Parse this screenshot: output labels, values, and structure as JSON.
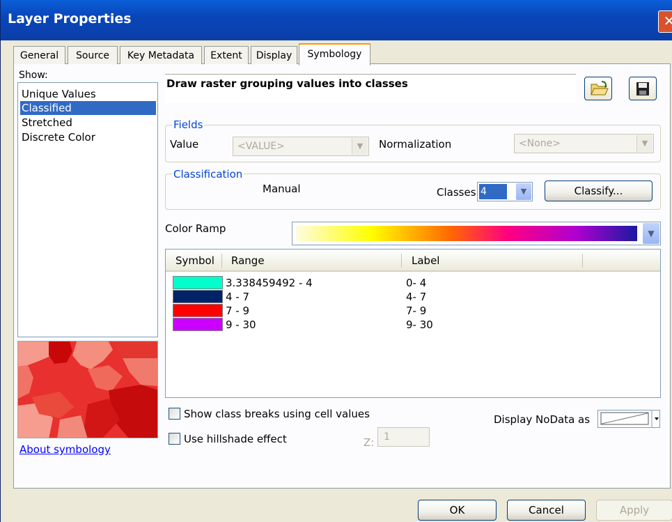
{
  "window": {
    "title": "Layer Properties"
  },
  "tabs": [
    {
      "label": "General"
    },
    {
      "label": "Source"
    },
    {
      "label": "Key Metadata"
    },
    {
      "label": "Extent"
    },
    {
      "label": "Display"
    },
    {
      "label": "Symbology",
      "active": true
    }
  ],
  "show": {
    "label": "Show:",
    "items": [
      "Unique Values",
      "Classified",
      "Stretched",
      "Discrete Color"
    ],
    "selected": "Classified"
  },
  "about_link": "About symbology",
  "description": "Draw raster grouping values into classes",
  "icons": {
    "open": "open-folder-icon",
    "save": "save-disk-icon",
    "close": "close-icon",
    "dropdown": "chevron-down-icon"
  },
  "fields": {
    "title": "Fields",
    "value_label": "Value",
    "value_select": "<VALUE>",
    "normalization_label": "Normalization",
    "normalization_select": "<None>"
  },
  "classification": {
    "title": "Classification",
    "method": "Manual",
    "classes_label": "Classes",
    "classes_value": "4",
    "classify_button": "Classify..."
  },
  "color_ramp": {
    "label": "Color Ramp",
    "colors": [
      "#ffff00",
      "#ff6a00",
      "#ff0080",
      "#b000d0",
      "#1a1aa0"
    ]
  },
  "table": {
    "headers": {
      "symbol": "Symbol",
      "range": "Range",
      "label": "Label"
    },
    "rows": [
      {
        "color": "#00ffcc",
        "range": "3.338459492 - 4",
        "label": "0- 4"
      },
      {
        "color": "#002266",
        "range": "4 - 7",
        "label": "4- 7"
      },
      {
        "color": "#ff0000",
        "range": "7 - 9",
        "label": "7- 9"
      },
      {
        "color": "#cc00ff",
        "range": "9 - 30",
        "label": "9- 30"
      }
    ]
  },
  "options": {
    "class_breaks": "Show class breaks using cell values",
    "hillshade": "Use hillshade effect",
    "z_label": "Z:",
    "z_value": "1",
    "nodata_label": "Display NoData as"
  },
  "buttons": {
    "ok": "OK",
    "cancel": "Cancel",
    "apply": "Apply"
  }
}
